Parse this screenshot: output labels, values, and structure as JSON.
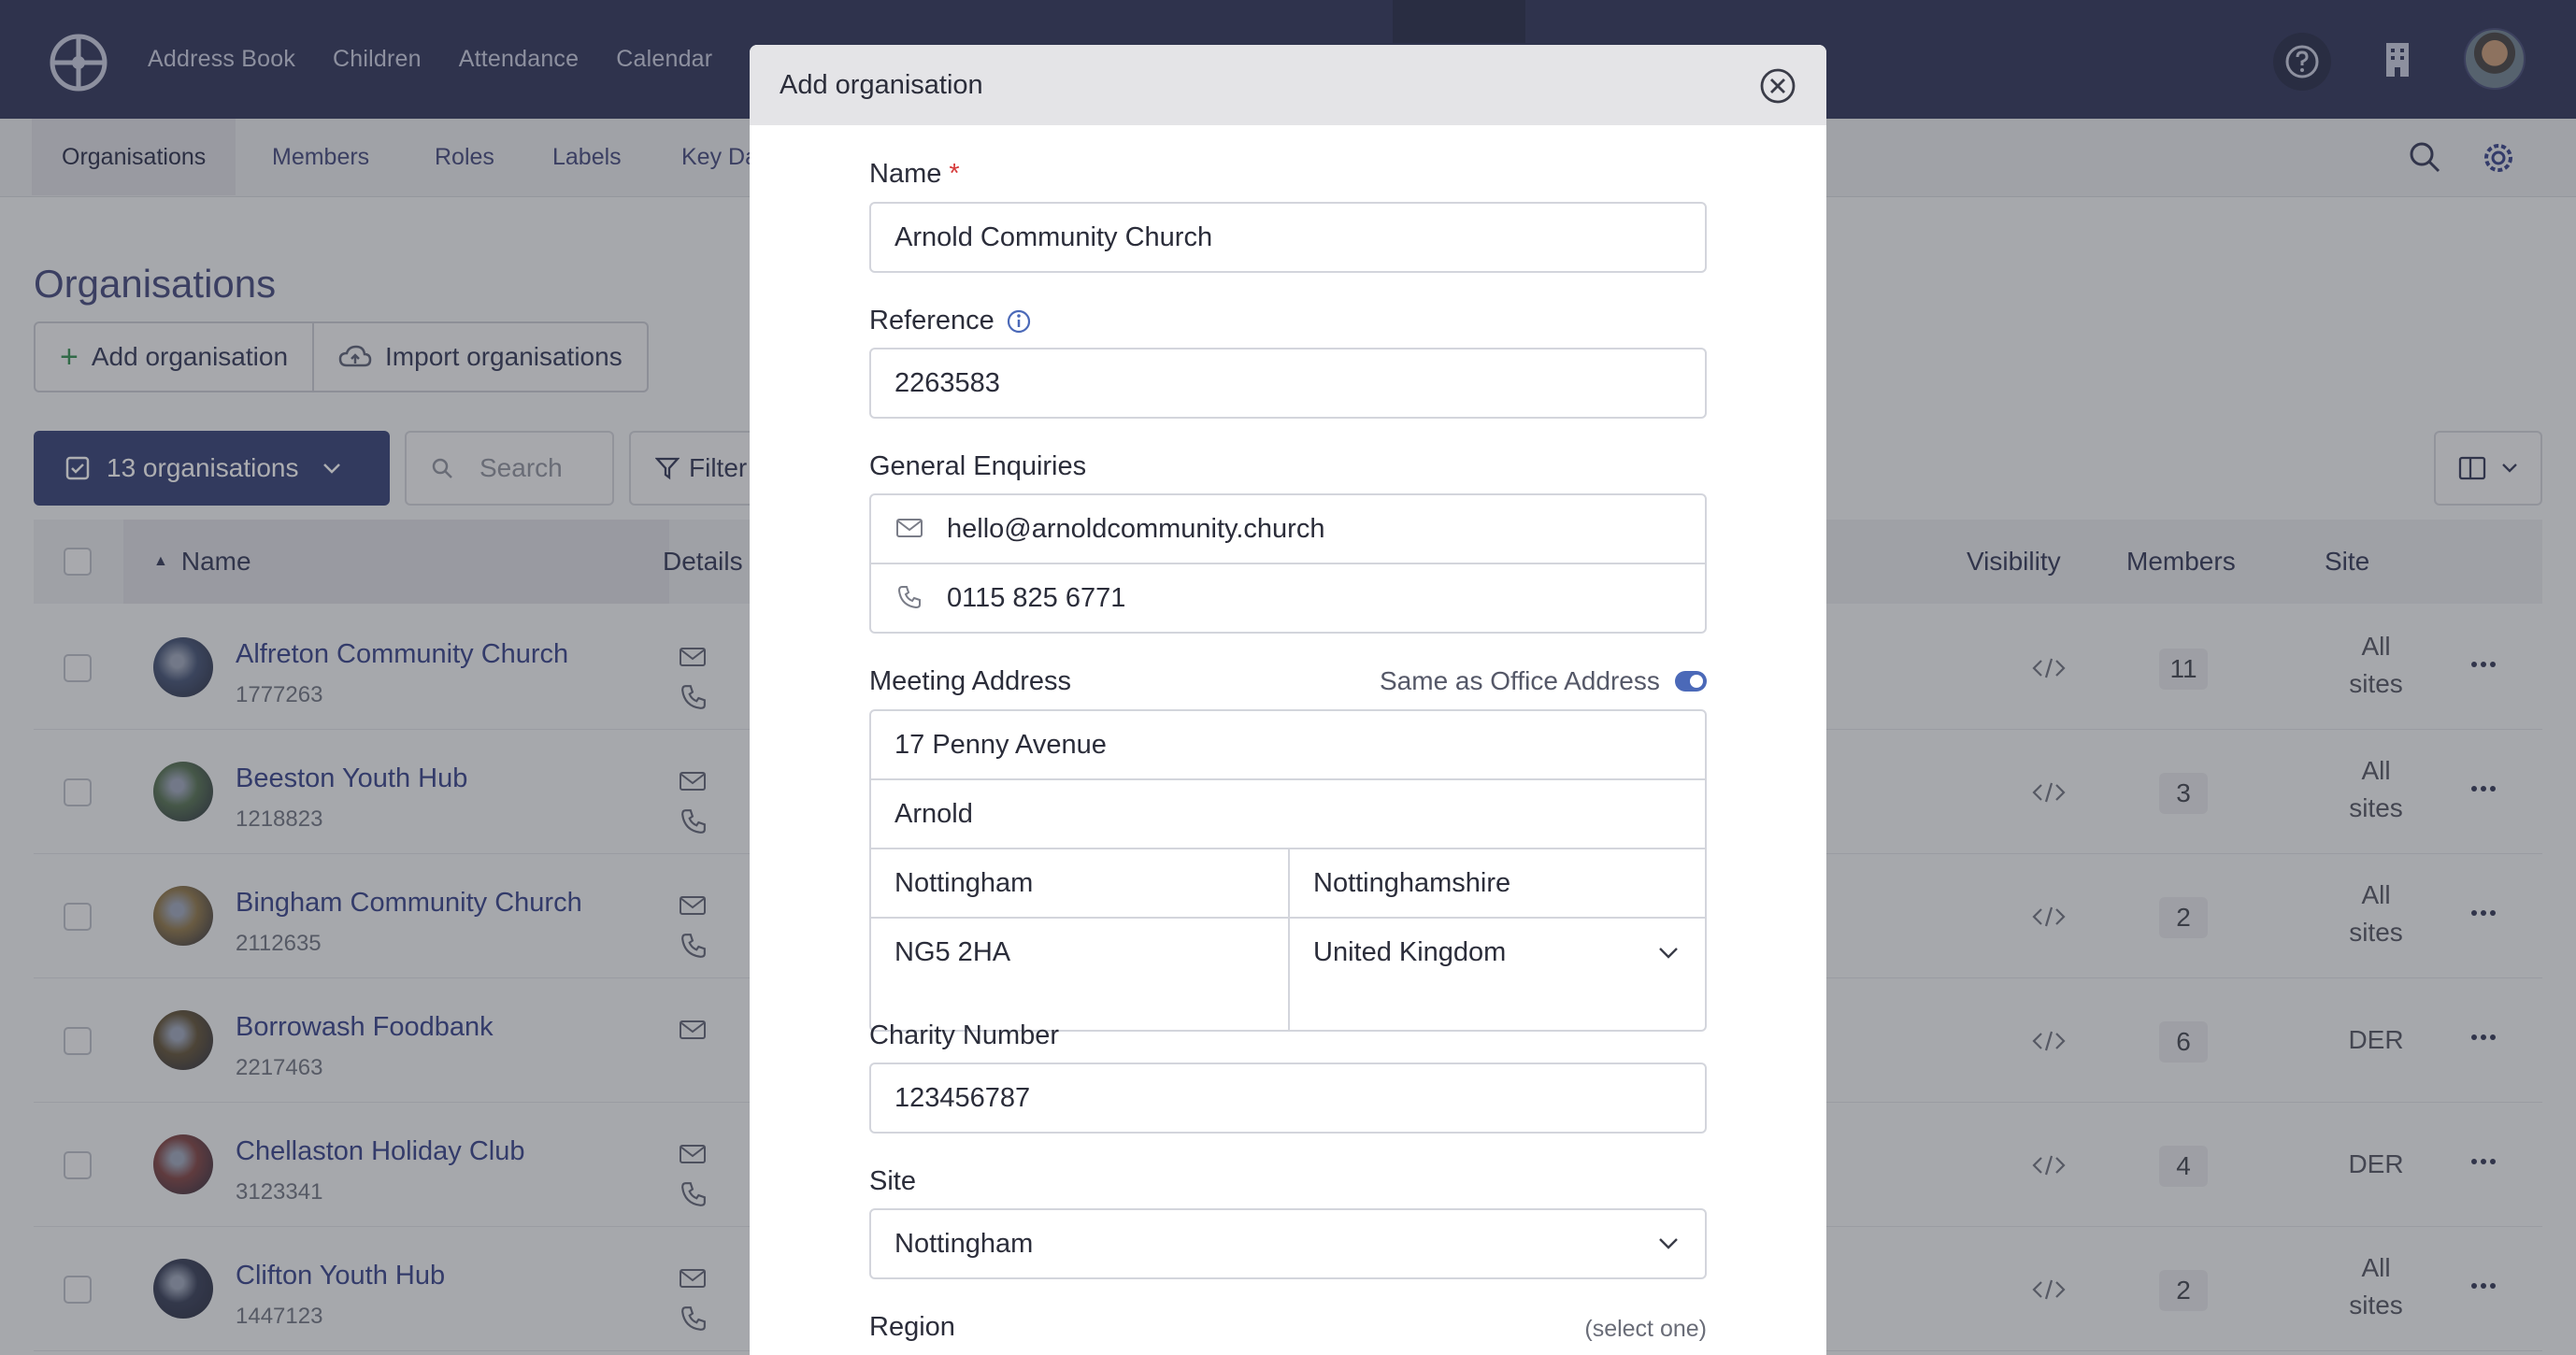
{
  "nav": {
    "links": [
      "Address Book",
      "Children",
      "Attendance",
      "Calendar"
    ]
  },
  "subnav": {
    "tabs": [
      "Organisations",
      "Members",
      "Roles",
      "Labels",
      "Key Da"
    ]
  },
  "page": {
    "title": "Organisations",
    "add_button": "Add organisation",
    "import_button": "Import organisations",
    "count_label": "13 organisations",
    "search_placeholder": "Search",
    "filter_label": "Filter"
  },
  "table": {
    "headers": {
      "name": "Name",
      "details": "Details",
      "visibility": "Visibility",
      "members": "Members",
      "site": "Site"
    },
    "rows": [
      {
        "name": "Alfreton Community Church",
        "ref": "1777263",
        "members": "11",
        "site": "All sites",
        "has_phone": true,
        "avatar_color": "#3b4a6e"
      },
      {
        "name": "Beeston Youth Hub",
        "ref": "1218823",
        "members": "3",
        "site": "All sites",
        "has_phone": true,
        "avatar_color": "#4d6a4a"
      },
      {
        "name": "Bingham Community Church",
        "ref": "2112635",
        "members": "2",
        "site": "All sites",
        "has_phone": true,
        "avatar_color": "#8a7040"
      },
      {
        "name": "Borrowash Foodbank",
        "ref": "2217463",
        "members": "6",
        "site": "DER",
        "has_phone": false,
        "avatar_color": "#5a4a2e"
      },
      {
        "name": "Chellaston Holiday Club",
        "ref": "3123341",
        "members": "4",
        "site": "DER",
        "has_phone": true,
        "avatar_color": "#7a3a3a"
      },
      {
        "name": "Clifton Youth Hub",
        "ref": "1447123",
        "members": "2",
        "site": "All sites",
        "has_phone": true,
        "avatar_color": "#2e3550"
      }
    ]
  },
  "modal": {
    "title": "Add organisation",
    "name_label": "Name",
    "required_mark": "*",
    "name_value": "Arnold Community Church",
    "reference_label": "Reference",
    "reference_value": "2263583",
    "enquiries_label": "General Enquiries",
    "email_value": "hello@arnoldcommunity.church",
    "phone_value": "0115 825 6771",
    "meeting_label": "Meeting Address",
    "same_as_label": "Same as Office Address",
    "same_as_on": true,
    "address_line1": "17 Penny Avenue",
    "address_line2": "Arnold",
    "city": "Nottingham",
    "county": "Nottinghamshire",
    "postcode": "NG5 2HA",
    "country": "United Kingdom",
    "charity_label": "Charity Number",
    "charity_value": "123456787",
    "site_label": "Site",
    "site_value": "Nottingham",
    "region_label": "Region",
    "region_hint": "(select one)"
  },
  "colors": {
    "nav_bg": "#272c54",
    "accent": "#2c3770",
    "link": "#2e3a86",
    "required": "#d63a3a",
    "toggle_on": "#4b69b8"
  }
}
